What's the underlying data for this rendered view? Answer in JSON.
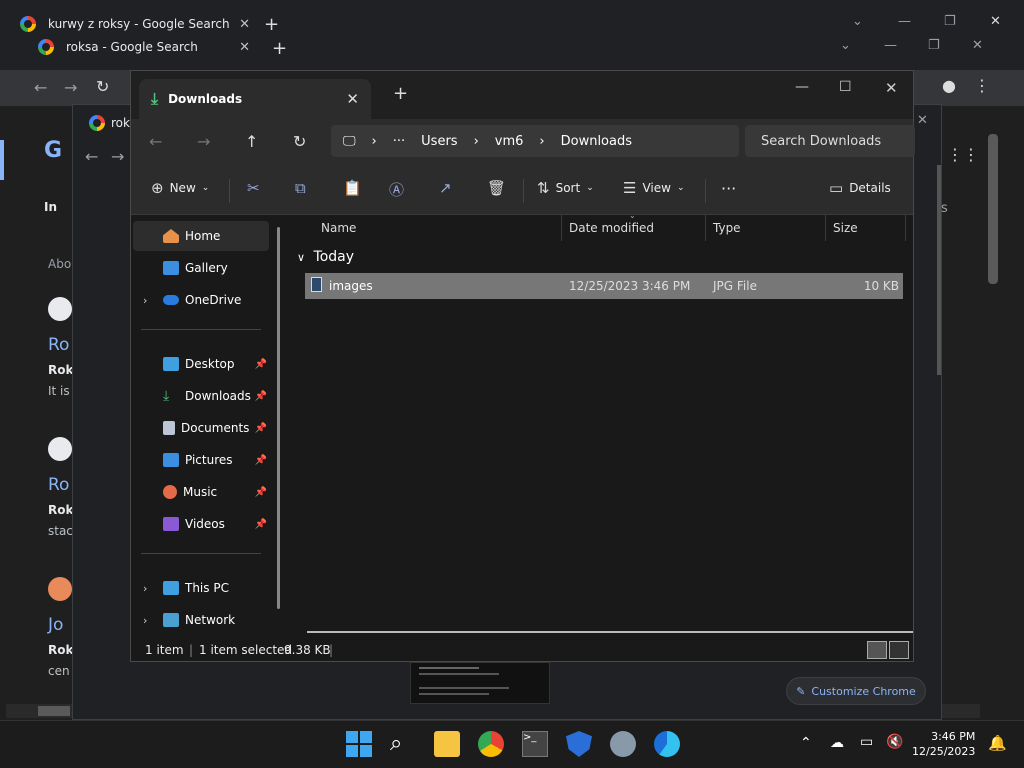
{
  "chrome_back": {
    "tab1_title": "kurwy z roksy - Google Search",
    "tab2_title": "roksa - Google Search",
    "tab3_title": "roks",
    "page_frag": {
      "in": "In",
      "abc": "Abo",
      "ro1": "Ro",
      "rok1": "Rok",
      "itis": "It is",
      "ro2": "Ro",
      "rok2": "Rok",
      "sta": "stac",
      "jo": "Jo",
      "rok3": "Rok",
      "cen": "cen",
      "s": "s"
    },
    "customize_label": "Customize Chrome"
  },
  "explorer": {
    "tab_title": "Downloads",
    "breadcrumb": [
      "Users",
      "vm6",
      "Downloads"
    ],
    "search_placeholder": "Search Downloads",
    "commands": {
      "new": "New",
      "sort": "Sort",
      "view": "View",
      "details": "Details"
    },
    "nav": {
      "home": "Home",
      "gallery": "Gallery",
      "onedrive": "OneDrive",
      "desktop": "Desktop",
      "downloads": "Downloads",
      "documents": "Documents",
      "pictures": "Pictures",
      "music": "Music",
      "videos": "Videos",
      "thispc": "This PC",
      "network": "Network"
    },
    "columns": [
      "Name",
      "Date modified",
      "Type",
      "Size"
    ],
    "group": "Today",
    "file": {
      "name": "images",
      "date": "12/25/2023 3:46 PM",
      "type": "JPG File",
      "size": "10 KB"
    },
    "status": {
      "count": "1 item",
      "selected": "1 item selected",
      "size": "9.38 KB"
    }
  },
  "taskbar": {
    "time": "3:46 PM",
    "date": "12/25/2023"
  }
}
